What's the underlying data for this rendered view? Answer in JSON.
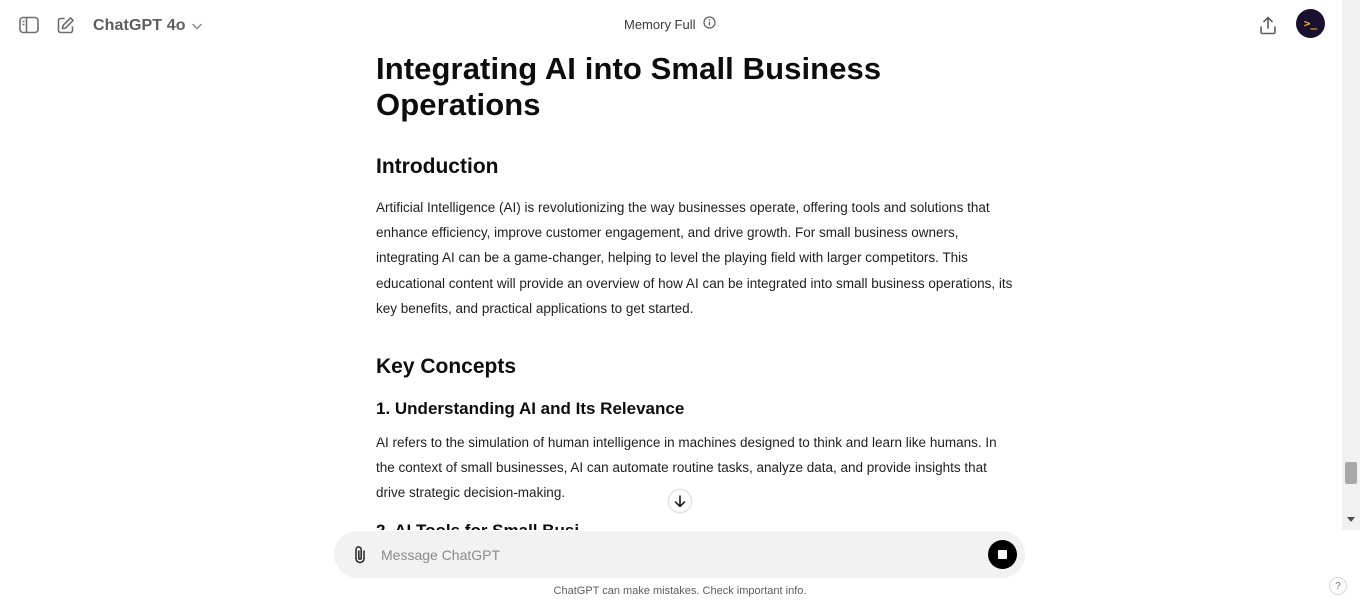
{
  "header": {
    "model_name": "ChatGPT 4o",
    "memory_status": "Memory Full",
    "avatar_text": ">_",
    "icons": [
      "sidebar-toggle-icon",
      "new-chat-icon",
      "chevron-down-icon",
      "info-icon",
      "share-icon"
    ]
  },
  "article": {
    "title": "Integrating AI into Small Business Operations",
    "intro_heading": "Introduction",
    "intro_text": "Artificial Intelligence (AI) is revolutionizing the way businesses operate, offering tools and solutions that enhance efficiency, improve customer engagement, and drive growth. For small business owners, integrating AI can be a game-changer, helping to level the playing field with larger competitors. This educational content will provide an overview of how AI can be integrated into small business operations, its key benefits, and practical applications to get started.",
    "key_heading": "Key Concepts",
    "section1_heading": "1. Understanding AI and Its Relevance",
    "section1_text": "AI refers to the simulation of human intelligence in machines designed to think and learn like humans. In the context of small businesses, AI can automate routine tasks, analyze data, and provide insights that drive strategic decision-making.",
    "section2_heading_partial": "2. AI Tools for Small Busi"
  },
  "composer": {
    "placeholder": "Message ChatGPT",
    "value": ""
  },
  "footer": {
    "disclaimer": "ChatGPT can make mistakes. Check important info.",
    "help_label": "?"
  },
  "colors": {
    "accent_black": "#000000",
    "composer_bg": "#f2f2f2",
    "avatar_bg": "#1a1030",
    "avatar_fg": "#f6c21d"
  }
}
